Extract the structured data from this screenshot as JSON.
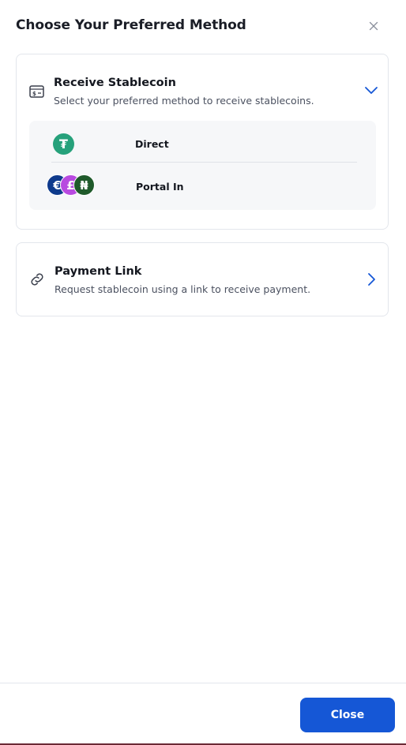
{
  "dialog": {
    "title": "Choose Your Preferred Method",
    "close_icon": "close-icon"
  },
  "receive_stablecoin": {
    "icon": "wallet-card-icon",
    "title": "Receive Stablecoin",
    "subtitle": "Select your preferred method to receive stablecoins.",
    "expanded": true,
    "chevron_icon": "chevron-down-icon",
    "options": [
      {
        "label": "Direct",
        "icon": "tether-icon",
        "icon_glyph": "₮",
        "color": "#26a17b"
      },
      {
        "label": "Portal In",
        "icons": [
          {
            "name": "euro-icon",
            "glyph": "€",
            "color": "#0e3a8c"
          },
          {
            "name": "pound-icon",
            "glyph": "£",
            "color": "#b84ae0"
          },
          {
            "name": "naira-icon",
            "glyph": "₦",
            "color": "#1f5a2b"
          }
        ]
      }
    ]
  },
  "payment_link": {
    "icon": "link-icon",
    "title": "Payment Link",
    "subtitle": "Request stablecoin using a link to receive payment.",
    "chevron_icon": "chevron-right-icon"
  },
  "footer": {
    "close_label": "Close",
    "accent": "#1557d6"
  }
}
